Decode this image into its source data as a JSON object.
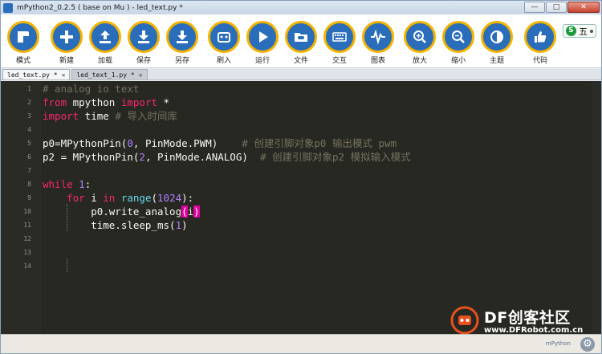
{
  "window": {
    "title": "mPython2_0.2.5 ( base on Mu ) - led_text.py *",
    "controls": {
      "minimize": "—",
      "maximize": "□",
      "close": "✕"
    }
  },
  "toolbar": {
    "buttons": [
      {
        "id": "mode",
        "label": "模式",
        "icon": "mode-icon"
      },
      {
        "id": "new",
        "label": "新建",
        "icon": "plus-icon"
      },
      {
        "id": "load",
        "label": "加载",
        "icon": "upload-icon"
      },
      {
        "id": "save",
        "label": "保存",
        "icon": "download-icon"
      },
      {
        "id": "save-as",
        "label": "另存",
        "icon": "save-as-icon"
      },
      {
        "id": "flash",
        "label": "刷入",
        "icon": "board-icon"
      },
      {
        "id": "run",
        "label": "运行",
        "icon": "play-icon"
      },
      {
        "id": "files",
        "label": "文件",
        "icon": "folder-icon"
      },
      {
        "id": "repl",
        "label": "交互",
        "icon": "keyboard-icon"
      },
      {
        "id": "plotter",
        "label": "图表",
        "icon": "pulse-icon"
      },
      {
        "id": "zoom-in",
        "label": "放大",
        "icon": "zoom-in-icon"
      },
      {
        "id": "zoom-out",
        "label": "缩小",
        "icon": "zoom-out-icon"
      },
      {
        "id": "theme",
        "label": "主题",
        "icon": "theme-icon"
      },
      {
        "id": "check",
        "label": "代码",
        "icon": "thumbs-up-icon"
      }
    ],
    "ime": {
      "text": "五"
    }
  },
  "tabs": [
    {
      "label": "led_text.py *",
      "active": true
    },
    {
      "label": "led_text_1.py *",
      "active": false
    }
  ],
  "editor": {
    "line_numbers": [
      "1",
      "2",
      "3",
      "4",
      "5",
      "6",
      "7",
      "8",
      "9",
      "10",
      "11",
      "12",
      "13",
      "14"
    ],
    "lines": {
      "l1_comment": "# analog io text",
      "l2_from": "from",
      "l2_mod": " mpython ",
      "l2_import": "import",
      "l2_star": " *",
      "l3_import": "import",
      "l3_mod": " time ",
      "l3_comment": "# 导入时间库",
      "l5_code_a": "p0=MPythonPin(",
      "l5_num": "0",
      "l5_code_b": ", PinMode.PWM)    ",
      "l5_comment": "# 创建引脚对象p0 输出模式 pwm",
      "l6_code_a": "p2 = MPythonPin(",
      "l6_num": "2",
      "l6_code_b": ", PinMode.ANALOG)  ",
      "l6_comment": "# 创建引脚对象p2 模拟输入模式",
      "l8_while": "while",
      "l8_num": " 1",
      "l8_colon": ":",
      "l9_indent": "    ",
      "l9_for": "for",
      "l9_i": " i ",
      "l9_in": "in",
      "l9_sp": " ",
      "l9_range": "range",
      "l9_open": "(",
      "l9_num": "1024",
      "l9_close": "):",
      "l10_code": "        p0.write_analog",
      "l10_paren_open": "(",
      "l10_arg": "i",
      "l10_paren_close": ")",
      "l11_code_a": "        time.sleep_ms(",
      "l11_num": "1",
      "l11_code_b": ")"
    }
  },
  "statusbar": {
    "mode": "mPython"
  },
  "watermark": {
    "title": "DF创客社区",
    "url": "www.DFRobot.com.cn"
  }
}
